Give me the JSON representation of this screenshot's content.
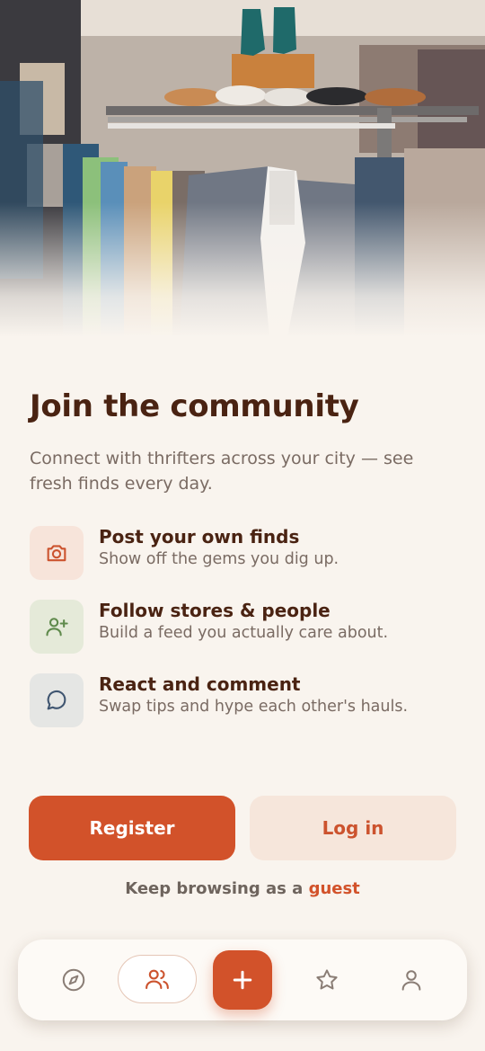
{
  "hero": {
    "image_alt": "Thrift store clothing rack with jackets and shoes on a shelf"
  },
  "onboarding": {
    "title": "Join the community",
    "subtitle": "Connect with thrifters across your city — see fresh finds every day."
  },
  "features": [
    {
      "icon": "camera-icon",
      "title": "Post your own finds",
      "description": "Show off the gems you dig up.",
      "bg": "#f7e4da",
      "fg": "#cc532e"
    },
    {
      "icon": "user-plus-icon",
      "title": "Follow stores & people",
      "description": "Build a feed you actually care about.",
      "bg": "#e5ead9",
      "fg": "#5f8a4c"
    },
    {
      "icon": "chat-bubble-icon",
      "title": "React and comment",
      "description": "Swap tips and hype each other's hauls.",
      "bg": "#e5e6e4",
      "fg": "#3f5570"
    }
  ],
  "actions": {
    "register_label": "Register",
    "login_label": "Log in",
    "guest_prefix": "Keep browsing as a",
    "guest_link": "guest"
  },
  "nav": {
    "items": [
      "compass-icon",
      "users-icon",
      "plus-icon",
      "star-icon",
      "user-icon"
    ],
    "active": "users-icon"
  },
  "colors": {
    "accent": "#d2522a",
    "background": "#f9f4ee",
    "heading": "#4a2312",
    "muted": "#7a6b63"
  }
}
